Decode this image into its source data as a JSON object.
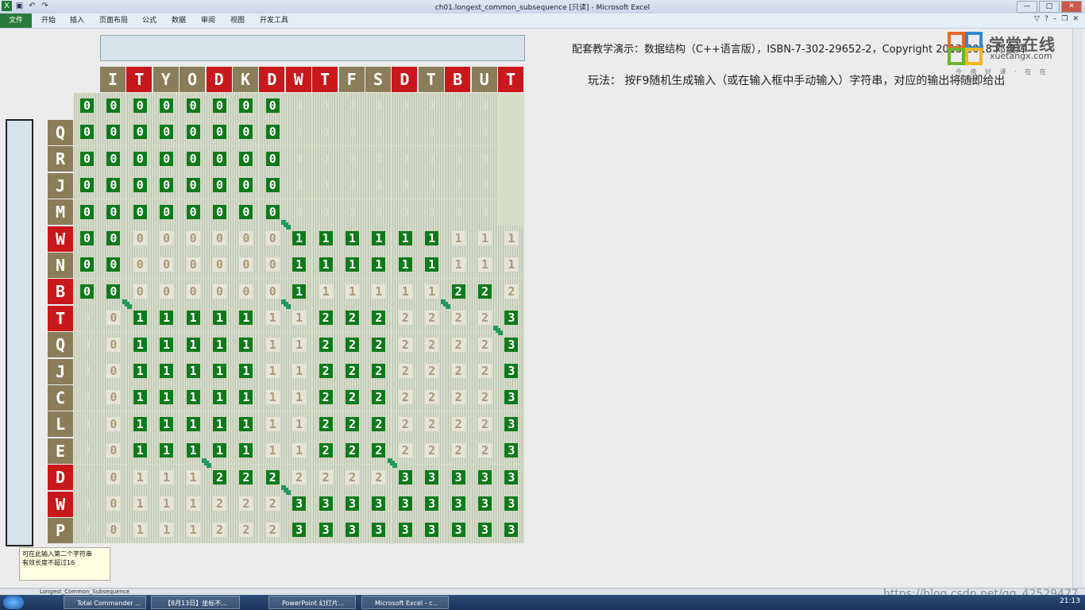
{
  "window": {
    "title": "ch01.longest_common_subsequence [只读] - Microsoft Excel",
    "controls": [
      "—",
      "□",
      "✕"
    ]
  },
  "ribbon": {
    "tabs": [
      "文件",
      "开始",
      "插入",
      "页面布局",
      "公式",
      "数据",
      "审阅",
      "视图",
      "开发工具"
    ]
  },
  "sheet": {
    "credit": "配套教学演示：数据结构（C++语言版），ISBN-7-302-29652-2，Copyright 2013-2018 邓俊辉",
    "howto": "玩法： 按F9随机生成输入（或在输入框中手动输入）字符串，对应的输出将随即给出",
    "logo_cn": "学堂在线",
    "logo_en": "xuetangx.com",
    "logo_tagline": "今 携 好 课 · 在 在 学 堂",
    "note_line1": "可在此输入第二个字符串",
    "note_line2": "有效长度不超过16",
    "sheet_tab": "Longest_Common_Subsequence"
  },
  "lcs": {
    "top_string": [
      "I",
      "T",
      "Y",
      "O",
      "D",
      "K",
      "D",
      "W",
      "T",
      "F",
      "S",
      "D",
      "T",
      "B",
      "U",
      "T"
    ],
    "top_match": [
      false,
      true,
      false,
      false,
      true,
      false,
      true,
      true,
      true,
      false,
      false,
      true,
      false,
      true,
      false,
      true
    ],
    "left_string": [
      "Q",
      "R",
      "J",
      "M",
      "W",
      "N",
      "B",
      "T",
      "Q",
      "J",
      "C",
      "L",
      "E",
      "D",
      "W",
      "P"
    ],
    "left_match": [
      false,
      false,
      false,
      false,
      true,
      false,
      true,
      true,
      false,
      false,
      false,
      false,
      false,
      true,
      true,
      false
    ],
    "table": [
      [
        0,
        0,
        0,
        0,
        0,
        0,
        0,
        0,
        0,
        0,
        0,
        0,
        0,
        0,
        0,
        0
      ],
      [
        0,
        0,
        0,
        0,
        0,
        0,
        0,
        0,
        0,
        0,
        0,
        0,
        0,
        0,
        0,
        0
      ],
      [
        0,
        0,
        0,
        0,
        0,
        0,
        0,
        0,
        0,
        0,
        0,
        0,
        0,
        0,
        0,
        0
      ],
      [
        0,
        0,
        0,
        0,
        0,
        0,
        0,
        0,
        0,
        0,
        0,
        0,
        0,
        0,
        0,
        0
      ],
      [
        0,
        0,
        0,
        0,
        0,
        0,
        0,
        0,
        0,
        0,
        0,
        0,
        0,
        0,
        0,
        0
      ],
      [
        0,
        0,
        0,
        0,
        0,
        0,
        0,
        0,
        1,
        1,
        1,
        1,
        1,
        1,
        1,
        1,
        1
      ],
      [
        0,
        0,
        0,
        0,
        0,
        0,
        0,
        0,
        1,
        1,
        1,
        1,
        1,
        1,
        1,
        1,
        1
      ],
      [
        0,
        0,
        0,
        0,
        0,
        0,
        0,
        0,
        1,
        1,
        1,
        1,
        1,
        1,
        2,
        2,
        2
      ],
      [
        0,
        0,
        1,
        1,
        1,
        1,
        1,
        1,
        1,
        2,
        2,
        2,
        2,
        2,
        2,
        2,
        3
      ],
      [
        0,
        0,
        1,
        1,
        1,
        1,
        1,
        1,
        1,
        2,
        2,
        2,
        2,
        2,
        2,
        2,
        3
      ],
      [
        0,
        0,
        1,
        1,
        1,
        1,
        1,
        1,
        1,
        2,
        2,
        2,
        2,
        2,
        2,
        2,
        3
      ],
      [
        0,
        0,
        1,
        1,
        1,
        1,
        1,
        1,
        1,
        2,
        2,
        2,
        2,
        2,
        2,
        2,
        3
      ],
      [
        0,
        0,
        1,
        1,
        1,
        1,
        1,
        1,
        1,
        2,
        2,
        2,
        2,
        2,
        2,
        2,
        3
      ],
      [
        0,
        0,
        1,
        1,
        1,
        1,
        1,
        1,
        1,
        2,
        2,
        2,
        2,
        2,
        2,
        2,
        3
      ],
      [
        0,
        0,
        1,
        1,
        1,
        2,
        2,
        2,
        2,
        2,
        2,
        2,
        3,
        3,
        3,
        3,
        3
      ],
      [
        0,
        0,
        1,
        1,
        1,
        2,
        2,
        2,
        3,
        3,
        3,
        3,
        3,
        3,
        3,
        3,
        3
      ],
      [
        0,
        0,
        1,
        1,
        1,
        2,
        2,
        2,
        3,
        3,
        3,
        3,
        3,
        3,
        3,
        3,
        3
      ]
    ],
    "highlight": [
      [
        1,
        1,
        1,
        1,
        1,
        1,
        1,
        1,
        0,
        0,
        0,
        0,
        0,
        0,
        0,
        0,
        0
      ],
      [
        1,
        1,
        1,
        1,
        1,
        1,
        1,
        1,
        0,
        0,
        0,
        0,
        0,
        0,
        0,
        0,
        0
      ],
      [
        1,
        1,
        1,
        1,
        1,
        1,
        1,
        1,
        0,
        0,
        0,
        0,
        0,
        0,
        0,
        0,
        0
      ],
      [
        1,
        1,
        1,
        1,
        1,
        1,
        1,
        1,
        0,
        0,
        0,
        0,
        0,
        0,
        0,
        0,
        0
      ],
      [
        1,
        1,
        1,
        1,
        1,
        1,
        1,
        1,
        0,
        0,
        0,
        0,
        0,
        0,
        0,
        0,
        0
      ],
      [
        1,
        1,
        0,
        0,
        0,
        0,
        0,
        0,
        1,
        1,
        1,
        1,
        1,
        1,
        0,
        0,
        0
      ],
      [
        1,
        1,
        0,
        0,
        0,
        0,
        0,
        0,
        1,
        1,
        1,
        1,
        1,
        1,
        0,
        0,
        0
      ],
      [
        1,
        1,
        0,
        0,
        0,
        0,
        0,
        0,
        1,
        0,
        0,
        0,
        0,
        0,
        1,
        1,
        0
      ],
      [
        0,
        0,
        1,
        1,
        1,
        1,
        1,
        0,
        0,
        1,
        1,
        1,
        0,
        0,
        0,
        0,
        1
      ],
      [
        0,
        0,
        1,
        1,
        1,
        1,
        1,
        0,
        0,
        1,
        1,
        1,
        0,
        0,
        0,
        0,
        1
      ],
      [
        0,
        0,
        1,
        1,
        1,
        1,
        1,
        0,
        0,
        1,
        1,
        1,
        0,
        0,
        0,
        0,
        1
      ],
      [
        0,
        0,
        1,
        1,
        1,
        1,
        1,
        0,
        0,
        1,
        1,
        1,
        0,
        0,
        0,
        0,
        1
      ],
      [
        0,
        0,
        1,
        1,
        1,
        1,
        1,
        0,
        0,
        1,
        1,
        1,
        0,
        0,
        0,
        0,
        1
      ],
      [
        0,
        0,
        1,
        1,
        1,
        1,
        1,
        0,
        0,
        1,
        1,
        1,
        0,
        0,
        0,
        0,
        1
      ],
      [
        0,
        0,
        0,
        0,
        0,
        1,
        1,
        1,
        0,
        0,
        0,
        0,
        1,
        1,
        1,
        1,
        1
      ],
      [
        0,
        0,
        0,
        0,
        0,
        0,
        0,
        0,
        1,
        1,
        1,
        1,
        1,
        1,
        1,
        1,
        1
      ],
      [
        0,
        0,
        0,
        0,
        0,
        0,
        0,
        0,
        1,
        1,
        1,
        1,
        1,
        1,
        1,
        1,
        1
      ]
    ]
  },
  "taskbar": {
    "tasks": [
      "Total Commander ...",
      "【8月13日】坐标不...",
      "PowerPoint 幻灯片...",
      "Microsoft Excel - c..."
    ],
    "clock": "21:13"
  },
  "watermark": "https://blog.csdn.net/qq_42529477",
  "colors": {
    "match_green": "#0e7a1b",
    "header_red": "#c8181b",
    "header_olive": "#8b7d5a"
  }
}
